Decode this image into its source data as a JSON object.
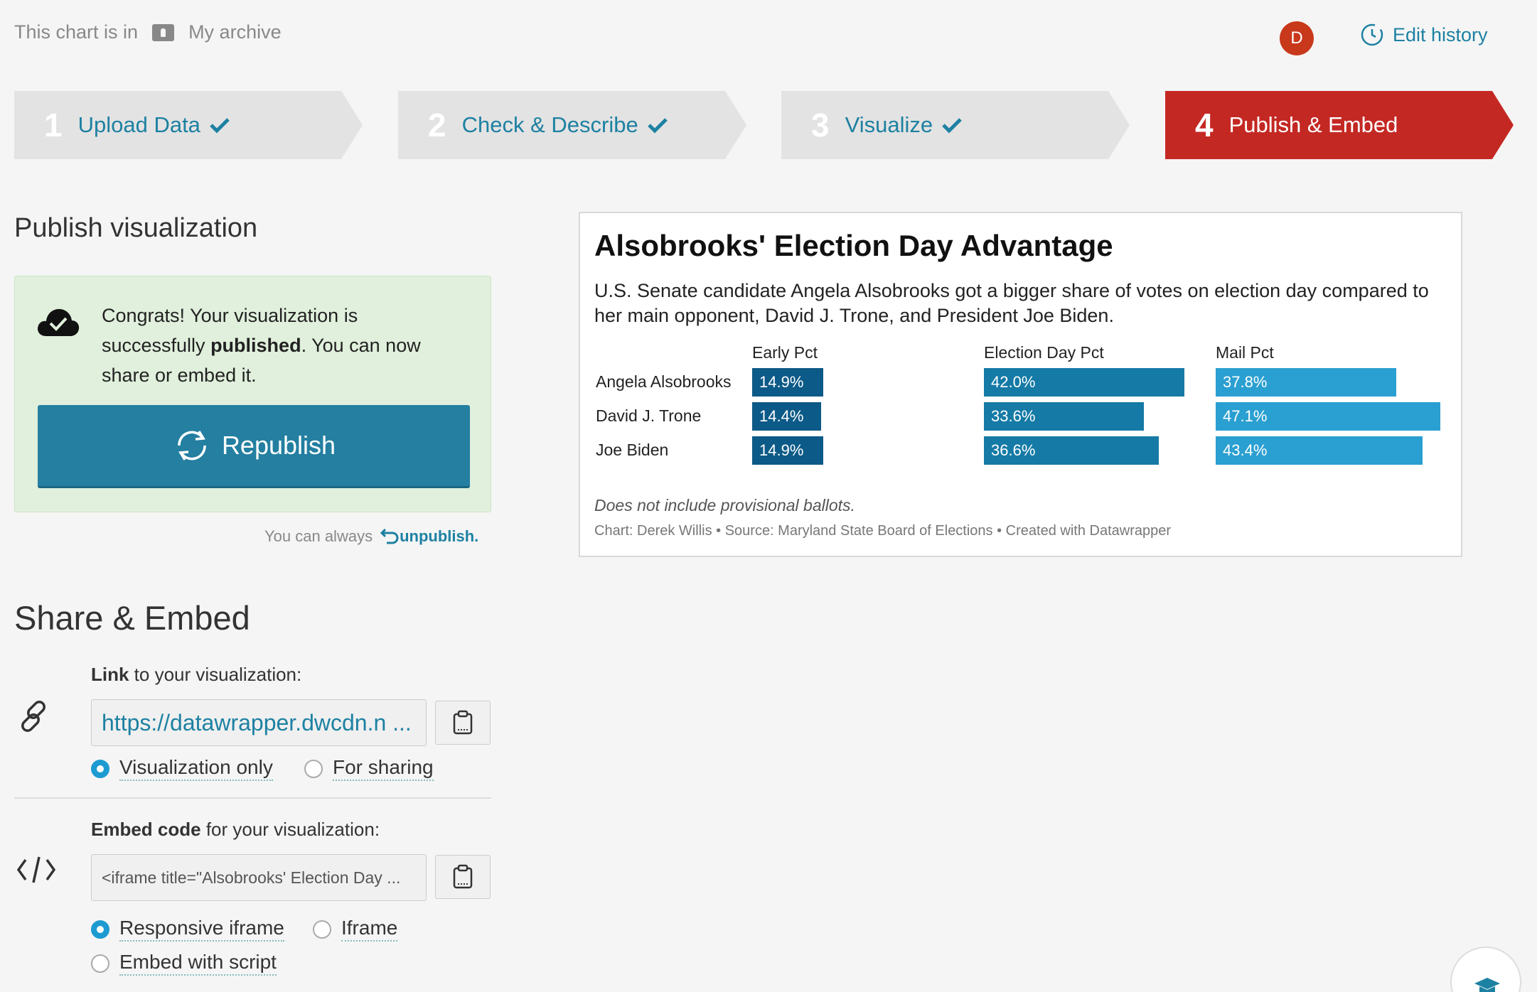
{
  "header": {
    "location_prefix": "This chart is in",
    "folder_name": "My archive",
    "avatar_initial": "D",
    "edit_history": "Edit history"
  },
  "steps": [
    {
      "num": "1",
      "label": "Upload Data",
      "done": true
    },
    {
      "num": "2",
      "label": "Check & Describe",
      "done": true
    },
    {
      "num": "3",
      "label": "Visualize",
      "done": true
    },
    {
      "num": "4",
      "label": "Publish & Embed",
      "active": true
    }
  ],
  "publish": {
    "title": "Publish visualization",
    "msg_before": "Congrats! Your visualization is successfully ",
    "msg_bold": "published",
    "msg_after": ". You can now share or embed it.",
    "republish": "Republish",
    "unpublish_prefix": "You can always",
    "unpublish_link": "unpublish."
  },
  "share": {
    "title": "Share & Embed",
    "link_label_bold": "Link",
    "link_label_rest": " to your visualization:",
    "link_value": "https://datawrapper.dwcdn.n ...",
    "link_options": [
      "Visualization only",
      "For sharing"
    ],
    "link_selected": "Visualization only",
    "embed_label_bold": "Embed code",
    "embed_label_rest": " for your visualization:",
    "embed_value": "<iframe title=\"Alsobrooks' Election Day  ...",
    "embed_options": [
      "Responsive iframe",
      "Iframe",
      "Embed with script"
    ],
    "embed_selected": "Responsive iframe"
  },
  "colors": {
    "accent": "#1d81a2",
    "active_step": "#c42823",
    "early": "#0c5a87",
    "election_day": "#157aa6",
    "mail": "#2a9fd1"
  },
  "chart_data": {
    "type": "table",
    "title": "Alsobrooks' Election Day Advantage",
    "subtitle": "U.S. Senate candidate Angela Alsobrooks got a bigger share of votes on election day compared to her main opponent, David J. Trone, and President Joe Biden.",
    "columns": [
      "Early Pct",
      "Election Day Pct",
      "Mail Pct"
    ],
    "rows": [
      "Angela Alsobrooks",
      "David J. Trone",
      "Joe Biden"
    ],
    "series": [
      {
        "name": "Early Pct",
        "values": [
          14.9,
          14.4,
          14.9
        ],
        "labels": [
          "14.9%",
          "14.4%",
          "14.9%"
        ]
      },
      {
        "name": "Election Day Pct",
        "values": [
          42.0,
          33.6,
          36.6
        ],
        "labels": [
          "42.0%",
          "33.6%",
          "36.6%"
        ]
      },
      {
        "name": "Mail Pct",
        "values": [
          37.8,
          47.1,
          43.4
        ],
        "labels": [
          "37.8%",
          "47.1%",
          "43.4%"
        ]
      }
    ],
    "note": "Does not include provisional ballots.",
    "source": "Chart: Derek Willis • Source: Maryland State Board of Elections • Created with Datawrapper"
  }
}
